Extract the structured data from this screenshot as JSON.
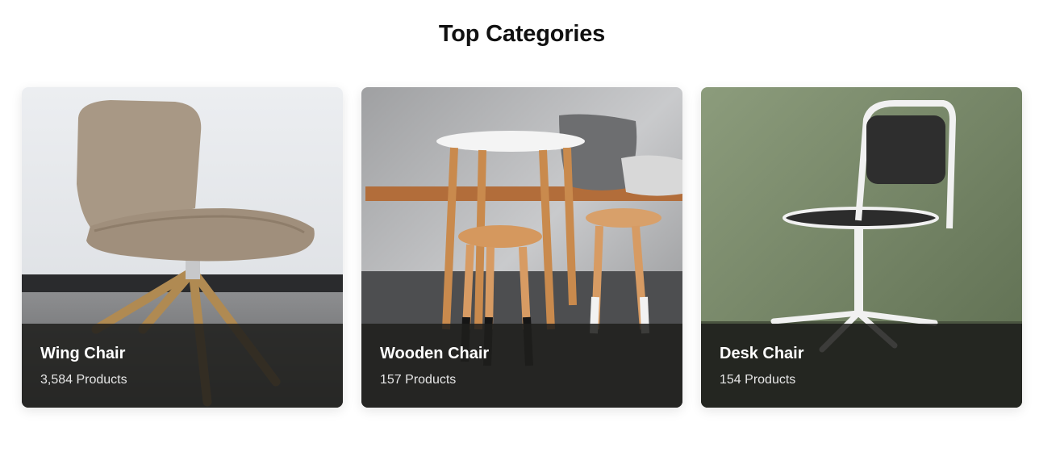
{
  "section": {
    "title": "Top Categories"
  },
  "categories": [
    {
      "name": "Wing Chair",
      "count": "3,584 Products",
      "image_icon": "wing-chair-photo"
    },
    {
      "name": "Wooden Chair",
      "count": "157 Products",
      "image_icon": "wooden-chair-photo"
    },
    {
      "name": "Desk Chair",
      "count": "154 Products",
      "image_icon": "desk-chair-photo"
    }
  ],
  "colors": {
    "overlay": "#1e1e1c",
    "title": "#111111",
    "text": "#ffffff"
  }
}
